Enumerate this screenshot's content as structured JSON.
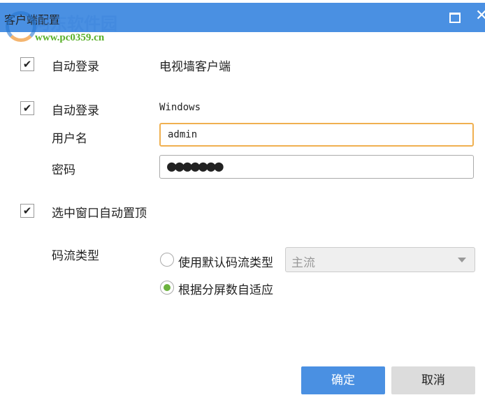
{
  "window": {
    "title": "客户端配置",
    "maximize_icon": "maximize-icon",
    "close_icon": "✕"
  },
  "watermark": {
    "name": "河东软件园",
    "url": "www.pc0359.cn"
  },
  "tv_wall": {
    "checked": true,
    "label": "自动登录",
    "value": "电视墙客户端"
  },
  "windows": {
    "checked": true,
    "label": "自动登录",
    "value": "Windows",
    "username_label": "用户名",
    "username": "admin",
    "password_label": "密码",
    "password": "●●●●●●●"
  },
  "topmost": {
    "checked": true,
    "label": "选中窗口自动置顶"
  },
  "stream": {
    "label": "码流类型",
    "option_default": "使用默认码流类型",
    "option_adaptive": "根据分屏数自适应",
    "selected": "adaptive",
    "select_value": "主流"
  },
  "buttons": {
    "ok": "确定",
    "cancel": "取消"
  },
  "colors": {
    "accent": "#4a90e2",
    "radio": "#6cb33e",
    "focus": "#f0b050"
  }
}
